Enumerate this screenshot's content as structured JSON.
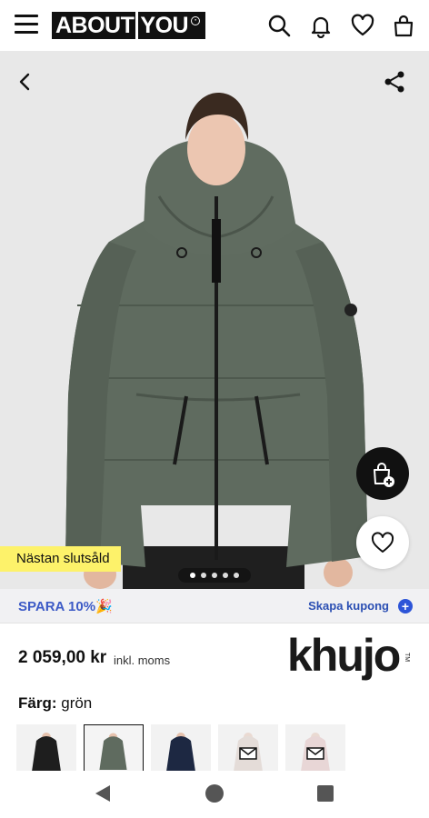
{
  "header": {
    "logo_text_left": "ABOUT",
    "logo_text_right": "YOU"
  },
  "product": {
    "badge": "Nästan slutsåld",
    "carousel_total": 5,
    "carousel_active": 1
  },
  "coupon": {
    "left_bold": "SPARA 10%",
    "left_emoji": "🎉",
    "right_label": "Skapa kupong"
  },
  "price": {
    "amount": "2 059,00 kr",
    "note": "inkl. moms"
  },
  "brand": {
    "name": "khujo",
    "tm": "TM"
  },
  "color": {
    "label": "Färg:",
    "value": "grön"
  },
  "thumbnails": [
    {
      "kind": "black-jacket",
      "selected": false
    },
    {
      "kind": "green-jacket",
      "selected": true
    },
    {
      "kind": "navy-jacket",
      "selected": false
    },
    {
      "kind": "mail-placeholder",
      "selected": false
    },
    {
      "kind": "mail-placeholder",
      "selected": false
    }
  ],
  "colors": {
    "coupon_text": "#3c5ac6",
    "badge_bg": "#fdf26a",
    "jacket_green": "#5f6b5f"
  },
  "icons": [
    "menu-icon",
    "search-icon",
    "bell-icon",
    "heart-icon",
    "bag-icon",
    "back-icon",
    "share-icon",
    "add-to-bag-icon",
    "wishlist-heart-icon",
    "plus-icon",
    "nav-back-icon",
    "nav-home-icon",
    "nav-recents-icon"
  ]
}
